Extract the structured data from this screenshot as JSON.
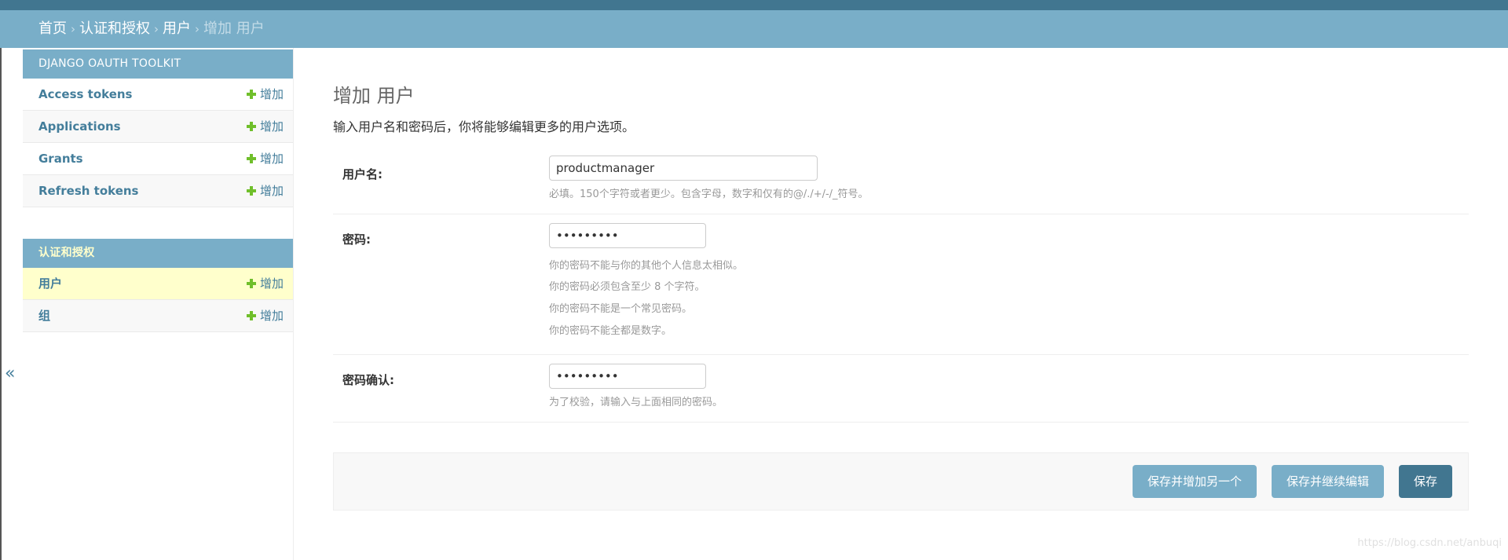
{
  "breadcrumb": {
    "items": [
      "首页",
      "认证和授权",
      "用户"
    ],
    "separator": "›",
    "current": "增加 用户"
  },
  "sidebar": {
    "toggle": "«",
    "modules": [
      {
        "caption": "DJANGO OAUTH TOOLKIT",
        "models": [
          {
            "name": "Access tokens",
            "add": "增加"
          },
          {
            "name": "Applications",
            "add": "增加"
          },
          {
            "name": "Grants",
            "add": "增加"
          },
          {
            "name": "Refresh tokens",
            "add": "增加"
          }
        ]
      },
      {
        "caption": "认证和授权",
        "models": [
          {
            "name": "用户",
            "add": "增加"
          },
          {
            "name": "组",
            "add": "增加"
          }
        ]
      }
    ]
  },
  "main": {
    "title": "增加 用户",
    "intro": "输入用户名和密码后，你将能够编辑更多的用户选项。",
    "fields": {
      "username": {
        "label": "用户名:",
        "value": "productmanager",
        "help": "必填。150个字符或者更少。包含字母，数字和仅有的@/./+/-/_符号。"
      },
      "password1": {
        "label": "密码:",
        "value": "•••••••••",
        "help": [
          "你的密码不能与你的其他个人信息太相似。",
          "你的密码必须包含至少 8 个字符。",
          "你的密码不能是一个常见密码。",
          "你的密码不能全都是数字。"
        ]
      },
      "password2": {
        "label": "密码确认:",
        "value": "•••••••••",
        "help": "为了校验，请输入与上面相同的密码。"
      }
    },
    "buttons": {
      "save_add_another": "保存并增加另一个",
      "save_continue": "保存并继续编辑",
      "save": "保存"
    }
  },
  "watermark": "https://blog.csdn.net/anbuqi",
  "colors": {
    "header": "#417690",
    "breadcrumb_bg": "#79aec8",
    "link": "#447e9b",
    "add_icon": "#70bf2b",
    "selected_row": "#ffffcc"
  }
}
